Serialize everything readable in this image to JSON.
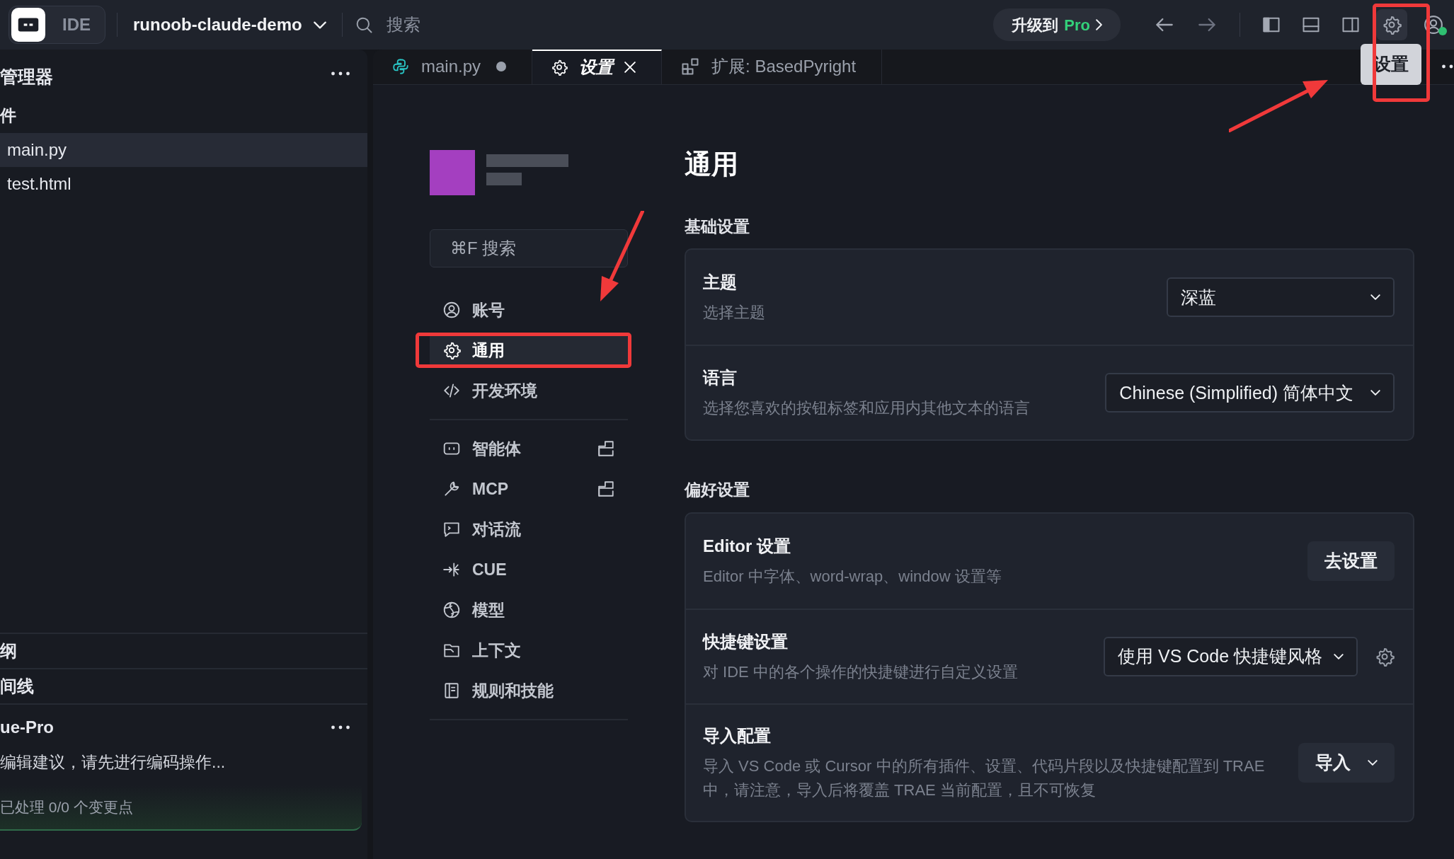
{
  "topbar": {
    "app_label": "IDE",
    "project": "runoob-claude-demo",
    "search": {
      "placeholder": "搜索"
    },
    "upgrade": {
      "text": "升级到",
      "pro": "Pro"
    },
    "settings_tooltip": "设置",
    "settings_annotated": true
  },
  "sidebar": {
    "title": "管理器",
    "section": "件",
    "files": [
      {
        "name": "main.py",
        "selected": true
      },
      {
        "name": "test.html",
        "selected": false
      }
    ],
    "panels": [
      "纲",
      "间线"
    ],
    "cue": {
      "title": "ue-Pro",
      "message": "编辑建议，请先进行编码操作...",
      "status": "已处理 0/0 个变更点"
    }
  },
  "tabs": [
    {
      "label": "main.py",
      "kind": "file",
      "selected": false,
      "modified": true
    },
    {
      "label": "设置",
      "kind": "settings",
      "selected": true,
      "modified": false
    },
    {
      "label": "扩展: BasedPyright",
      "kind": "extension",
      "selected": false,
      "modified": false
    }
  ],
  "settings_nav": {
    "search": {
      "placeholder": "⌘F 搜索"
    },
    "groups": [
      [
        {
          "label": "账号",
          "selected": false,
          "external": false,
          "annotated": false
        },
        {
          "label": "通用",
          "selected": true,
          "external": false,
          "annotated": true
        },
        {
          "label": "开发环境",
          "selected": false,
          "external": false,
          "annotated": false
        }
      ],
      [
        {
          "label": "智能体",
          "selected": false,
          "external": true,
          "annotated": false
        },
        {
          "label": "MCP",
          "selected": false,
          "external": true,
          "annotated": false
        },
        {
          "label": "对话流",
          "selected": false,
          "external": false,
          "annotated": false
        },
        {
          "label": "CUE",
          "selected": false,
          "external": false,
          "annotated": false
        },
        {
          "label": "模型",
          "selected": false,
          "external": false,
          "annotated": false
        },
        {
          "label": "上下文",
          "selected": false,
          "external": false,
          "annotated": false
        },
        {
          "label": "规则和技能",
          "selected": false,
          "external": false,
          "annotated": false
        }
      ]
    ]
  },
  "content": {
    "title": "通用",
    "sections": [
      {
        "title": "基础设置",
        "rows": [
          {
            "label": "主题",
            "description": "选择主题",
            "control": {
              "kind": "select",
              "value": "深蓝"
            }
          },
          {
            "label": "语言",
            "description": "选择您喜欢的按钮标签和应用内其他文本的语言",
            "control": {
              "kind": "select",
              "value": "Chinese (Simplified) 简体中文"
            }
          }
        ]
      },
      {
        "title": "偏好设置",
        "rows": [
          {
            "label": "Editor 设置",
            "description": "Editor 中字体、word-wrap、window 设置等",
            "control": {
              "kind": "button",
              "value": "去设置"
            }
          },
          {
            "label": "快捷键设置",
            "description": "对 IDE 中的各个操作的快捷键进行自定义设置",
            "control": {
              "kind": "select_gear",
              "value": "使用 VS Code 快捷键风格"
            }
          },
          {
            "label": "导入配置",
            "description": "导入 VS Code 或 Cursor 中的所有插件、设置、代码片段以及快捷键配置到 TRAE 中，请注意，导入后将覆盖 TRAE 当前配置，且不可恢复",
            "control": {
              "kind": "dropdown_button",
              "value": "导入"
            }
          }
        ]
      }
    ]
  }
}
